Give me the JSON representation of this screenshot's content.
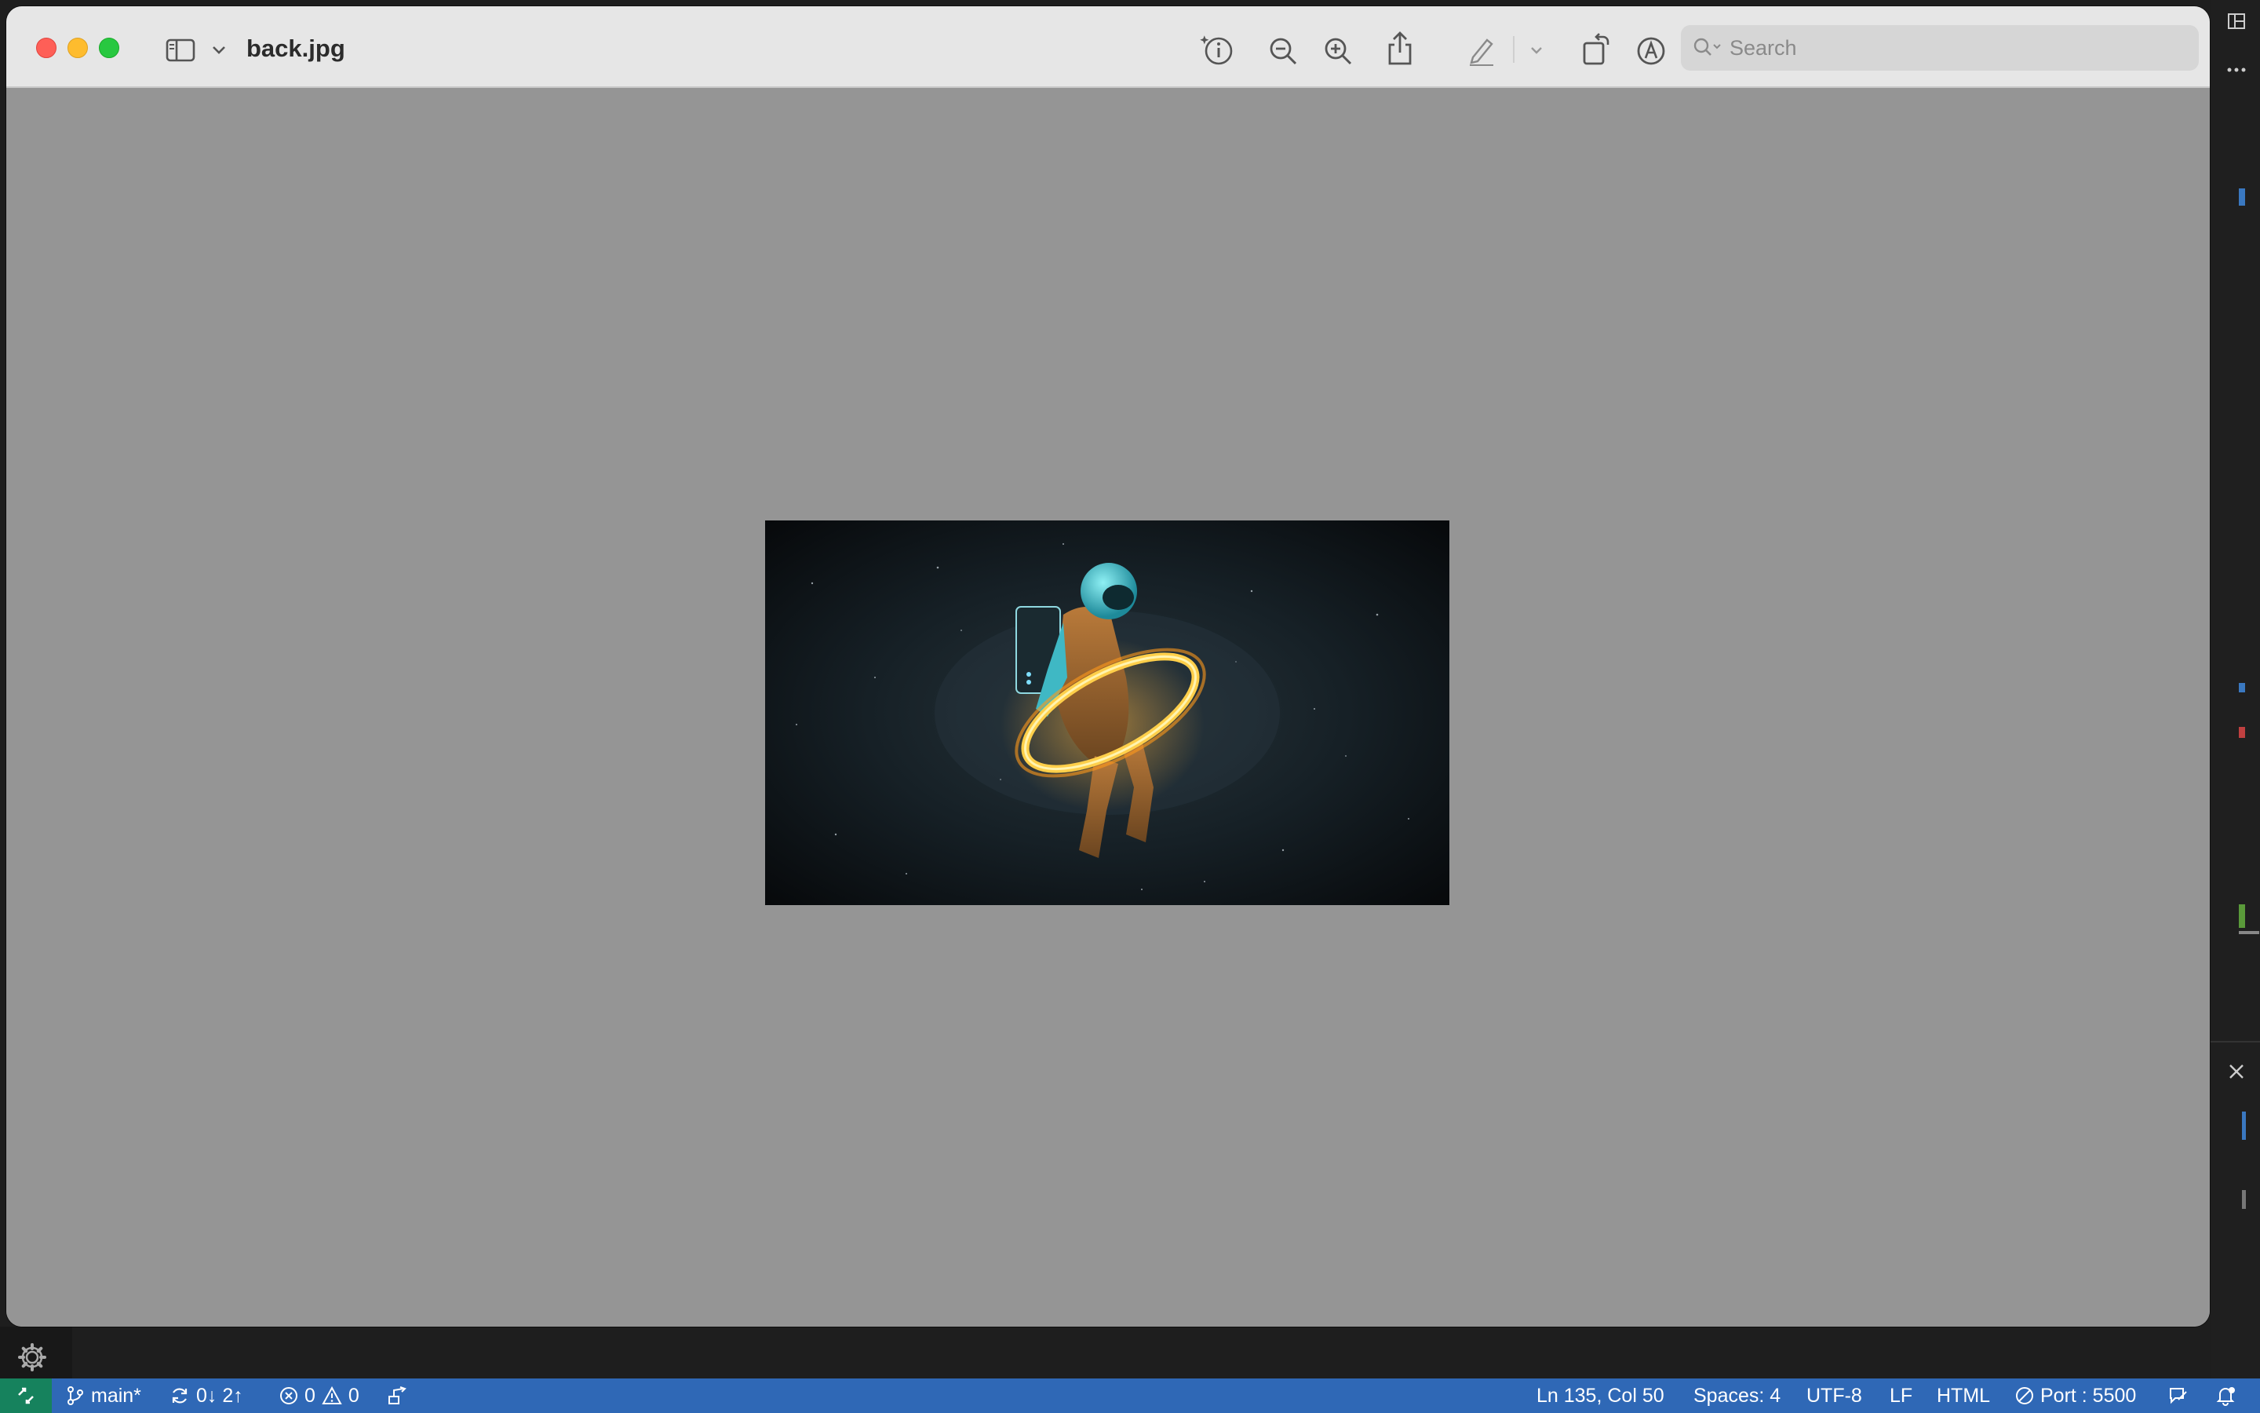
{
  "window": {
    "title": "back.jpg",
    "search_placeholder": "Search",
    "toolbar_icons": [
      "sidebar-icon",
      "chevron-down-icon",
      "info-icon",
      "zoom-out-icon",
      "zoom-in-icon",
      "share-icon",
      "markup-pen-icon",
      "chevron-down-icon",
      "rotate-icon",
      "annotate-icon",
      "search-icon"
    ]
  },
  "image": {
    "description_icon": "astronaut-with-glowing-ring"
  },
  "statusbar": {
    "branch": "main*",
    "sync": "0↓ 2↑",
    "errors": "0",
    "warnings": "0",
    "position": "Ln 135, Col 50",
    "spaces": "Spaces: 4",
    "encoding": "UTF-8",
    "eol": "LF",
    "language": "HTML",
    "port": "Port : 5500"
  },
  "colors": {
    "statusbar": "#2f68b6",
    "remote": "#16825d",
    "canvas": "#959595",
    "titlebar": "#e6e6e6"
  }
}
